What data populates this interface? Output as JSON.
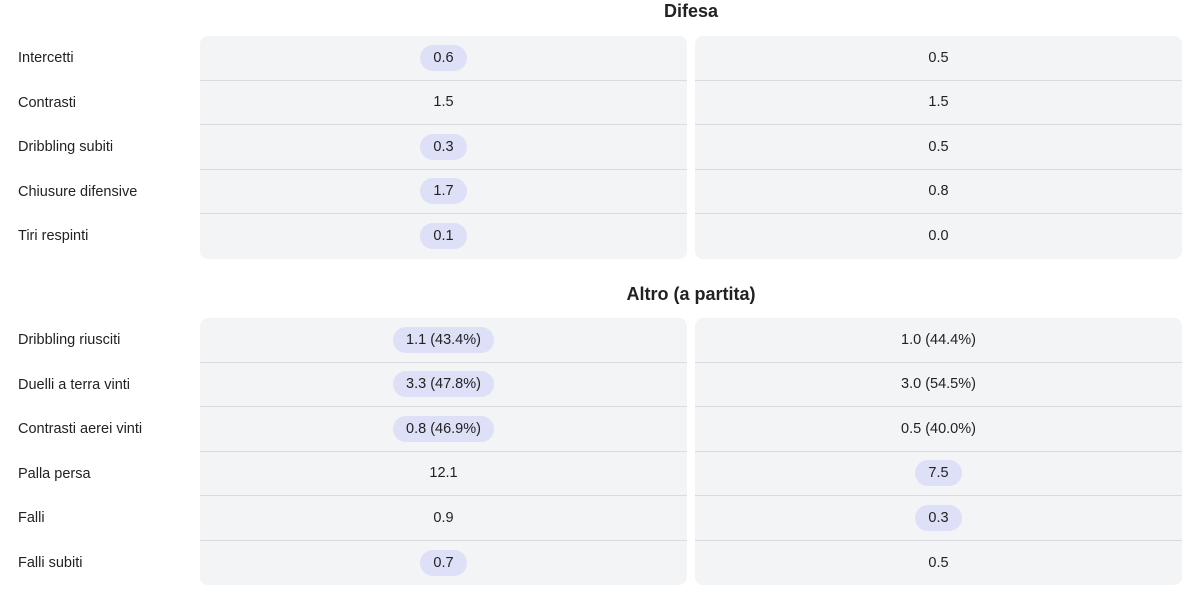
{
  "sections": [
    {
      "title": "Difesa",
      "rows": [
        {
          "label": "Intercetti",
          "left": {
            "value": "0.6",
            "highlight": true
          },
          "right": {
            "value": "0.5",
            "highlight": false
          }
        },
        {
          "label": "Contrasti",
          "left": {
            "value": "1.5",
            "highlight": false
          },
          "right": {
            "value": "1.5",
            "highlight": false
          }
        },
        {
          "label": "Dribbling subiti",
          "left": {
            "value": "0.3",
            "highlight": true
          },
          "right": {
            "value": "0.5",
            "highlight": false
          }
        },
        {
          "label": "Chiusure difensive",
          "left": {
            "value": "1.7",
            "highlight": true
          },
          "right": {
            "value": "0.8",
            "highlight": false
          }
        },
        {
          "label": "Tiri respinti",
          "left": {
            "value": "0.1",
            "highlight": true
          },
          "right": {
            "value": "0.0",
            "highlight": false
          }
        }
      ]
    },
    {
      "title": "Altro (a partita)",
      "rows": [
        {
          "label": "Dribbling riusciti",
          "left": {
            "value": "1.1 (43.4%)",
            "highlight": true
          },
          "right": {
            "value": "1.0 (44.4%)",
            "highlight": false
          }
        },
        {
          "label": "Duelli a terra vinti",
          "left": {
            "value": "3.3 (47.8%)",
            "highlight": true
          },
          "right": {
            "value": "3.0 (54.5%)",
            "highlight": false
          }
        },
        {
          "label": "Contrasti aerei vinti",
          "left": {
            "value": "0.8 (46.9%)",
            "highlight": true
          },
          "right": {
            "value": "0.5 (40.0%)",
            "highlight": false
          }
        },
        {
          "label": "Palla persa",
          "left": {
            "value": "12.1",
            "highlight": false
          },
          "right": {
            "value": "7.5",
            "highlight": true
          }
        },
        {
          "label": "Falli",
          "left": {
            "value": "0.9",
            "highlight": false
          },
          "right": {
            "value": "0.3",
            "highlight": true
          }
        },
        {
          "label": "Falli subiti",
          "left": {
            "value": "0.7",
            "highlight": true
          },
          "right": {
            "value": "0.5",
            "highlight": false
          }
        }
      ]
    }
  ],
  "colors": {
    "panel_bg": "#f3f4f6",
    "highlight_pill": "#dde0f6",
    "divider": "#d9dbe0",
    "text": "#222222"
  }
}
